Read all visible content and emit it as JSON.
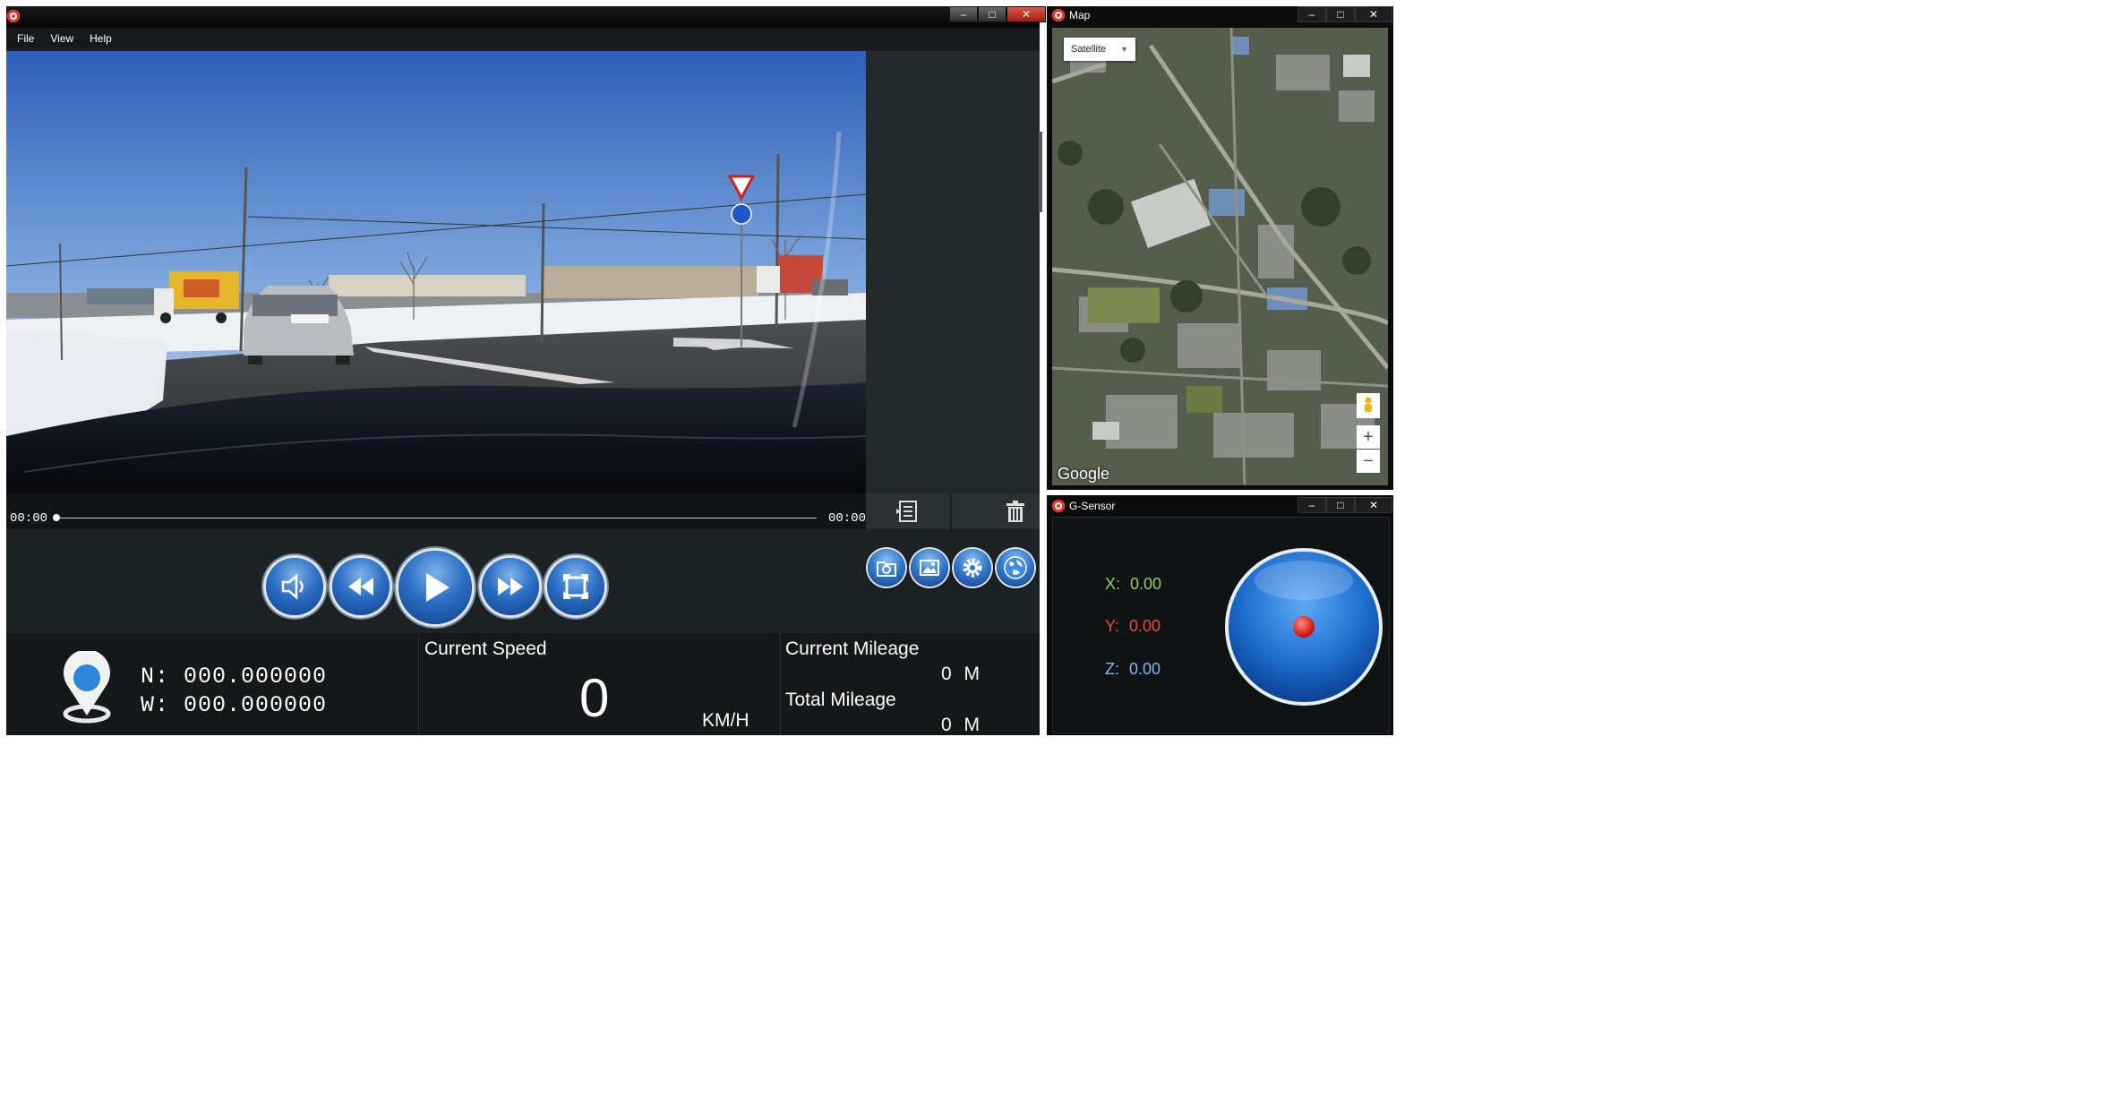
{
  "main_window": {
    "menu": [
      "File",
      "View",
      "Help"
    ],
    "window_buttons": [
      "–",
      "□",
      "✕"
    ]
  },
  "player": {
    "time_current": "00:00",
    "time_total": "00:00",
    "progress_percent": 0
  },
  "controls": {
    "buttons": [
      "volume-icon",
      "rewind-icon",
      "play-icon",
      "fast-forward-icon",
      "fullscreen-icon"
    ],
    "tools": [
      "open-folder-icon",
      "image-icon",
      "settings-icon",
      "globe-icon"
    ]
  },
  "info": {
    "lat_label": "N:",
    "lat_value": "000.000000",
    "lon_label": "W:",
    "lon_value": "000.000000",
    "speed_title": "Current Speed",
    "speed_value": "0",
    "speed_unit": "KM/H",
    "mileage_title": "Current Mileage",
    "mileage_value": "0",
    "mileage_unit": "M",
    "total_title": "Total Mileage",
    "total_value": "0",
    "total_unit": "M"
  },
  "map_window": {
    "title": "Map",
    "map_type": "Satellite",
    "provider": "Google",
    "zoom_in": "+",
    "zoom_out": "−"
  },
  "gsensor_window": {
    "title": "G-Sensor",
    "x_label": "X:",
    "x_value": "0.00",
    "y_label": "Y:",
    "y_value": "0.00",
    "z_label": "Z:",
    "z_value": "0.00"
  },
  "colors": {
    "x_axis": "#8fd16e",
    "y_axis": "#f04a3a",
    "z_axis": "#7fb8f0",
    "accent_blue": "#2c6fc4"
  }
}
